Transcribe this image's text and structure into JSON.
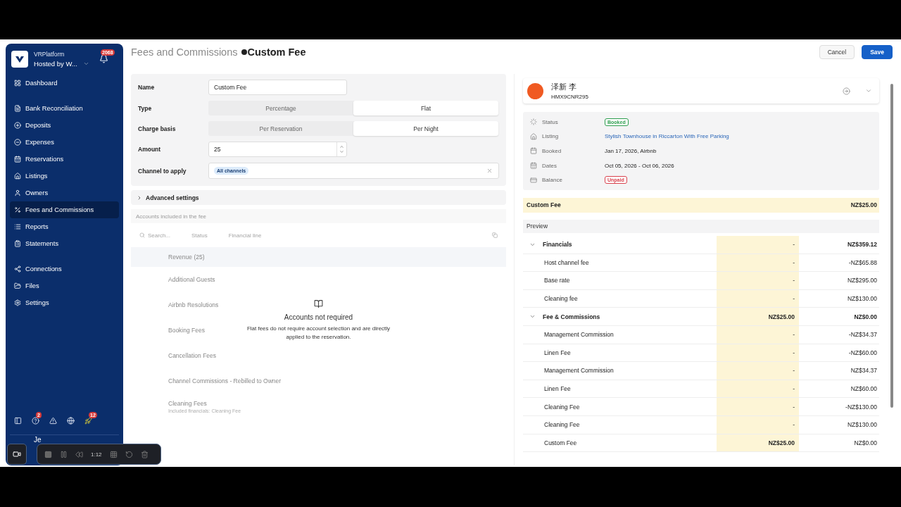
{
  "sidebar": {
    "org": "VRPlatform",
    "account": "Hosted by W...",
    "notification_count": "2068",
    "groups": [
      [
        {
          "label": "Dashboard",
          "selected": false
        }
      ],
      [
        {
          "label": "Bank Reconciliation",
          "selected": false
        },
        {
          "label": "Deposits",
          "selected": false
        },
        {
          "label": "Expenses",
          "selected": false
        },
        {
          "label": "Reservations",
          "selected": false
        },
        {
          "label": "Listings",
          "selected": false
        },
        {
          "label": "Owners",
          "selected": false
        },
        {
          "label": "Fees and Commissions",
          "selected": true
        },
        {
          "label": "Reports",
          "selected": false
        },
        {
          "label": "Statements",
          "selected": false
        }
      ],
      [
        {
          "label": "Connections",
          "selected": false
        },
        {
          "label": "Files",
          "selected": false
        },
        {
          "label": "Settings",
          "selected": false
        }
      ]
    ],
    "footer_icons": [
      {
        "kind": "panel"
      },
      {
        "kind": "help",
        "count": "2"
      },
      {
        "kind": "warning"
      },
      {
        "kind": "globe"
      },
      {
        "kind": "rocket",
        "count": "12"
      }
    ],
    "user": "Je"
  },
  "header": {
    "breadcrumb": "Fees and Commissions",
    "title": "Custom Fee",
    "buttons": [
      {
        "label": "Cancel",
        "kind": "secondary"
      },
      {
        "label": "Save",
        "kind": "primary"
      }
    ]
  },
  "form": {
    "fields": [
      {
        "label": "Name",
        "kind": "text",
        "value": "Custom Fee"
      },
      {
        "label": "Type",
        "kind": "segmented",
        "options": [
          {
            "label": "Percentage",
            "selected": false
          },
          {
            "label": "Flat",
            "selected": true
          }
        ]
      },
      {
        "label": "Charge basis",
        "kind": "segmented",
        "options": [
          {
            "label": "Per Reservation",
            "selected": false
          },
          {
            "label": "Per Night",
            "selected": true
          }
        ]
      },
      {
        "label": "Amount",
        "kind": "number",
        "value": "25"
      },
      {
        "label": "Channel to apply",
        "kind": "tags",
        "tags": [
          "All channels"
        ]
      }
    ],
    "advanced": {
      "label": "Advanced settings",
      "expanded": false
    }
  },
  "accounts": {
    "title": "Accounts included in the fee",
    "search_placeholder": "Search...",
    "filters": [
      "Status",
      "Financial line"
    ],
    "group": "Revenue (25)",
    "items": [
      {
        "name": "Additional Guests"
      },
      {
        "name": "Airbnb Resolutions"
      },
      {
        "name": "Booking Fees"
      },
      {
        "name": "Cancellation Fees"
      },
      {
        "name": "Channel Commissions - Rebilled to Owner"
      },
      {
        "name": "Cleaning Fees",
        "detail": "Included financials: Cleaning Fee"
      }
    ],
    "notice": {
      "title": "Accounts not required",
      "message": "Flat fees do not require account selection and are directly applied to the reservation."
    }
  },
  "reservation": {
    "guest": "泽新 李",
    "code": "HMX9CNR295",
    "details": [
      {
        "label": "Status",
        "value": "Booked",
        "kind": "badge",
        "color": "#2e9e4f"
      },
      {
        "label": "Listing",
        "value": "Stylish Townhouse in Riccarton With Free Parking",
        "kind": "link"
      },
      {
        "label": "Booked",
        "value": "Jan 17, 2026, Airbnb",
        "kind": "text"
      },
      {
        "label": "Dates",
        "value": "Oct 05, 2026 - Oct 06, 2026",
        "kind": "text"
      },
      {
        "label": "Balance",
        "value": "Unpaid",
        "kind": "badge",
        "color": "#d9434f"
      }
    ]
  },
  "fee_summary": {
    "label": "Custom Fee",
    "amount": "NZ$25.00"
  },
  "preview": {
    "title": "Preview",
    "rows": [
      {
        "label": "Financials",
        "fee": "-",
        "total": "NZ$359.12",
        "expanded": true,
        "children": [
          {
            "label": "Host channel fee",
            "fee": "-",
            "total": "-NZ$65.88"
          },
          {
            "label": "Base rate",
            "fee": "-",
            "total": "NZ$295.00"
          },
          {
            "label": "Cleaning fee",
            "fee": "-",
            "total": "NZ$130.00"
          }
        ]
      },
      {
        "label": "Fee & Commissions",
        "fee": "NZ$25.00",
        "total": "NZ$0.00",
        "expanded": true,
        "children": [
          {
            "label": "Management Commission",
            "fee": "-",
            "total": "-NZ$34.37"
          },
          {
            "label": "Linen Fee",
            "fee": "-",
            "total": "-NZ$60.00"
          },
          {
            "label": "Management Commission",
            "fee": "-",
            "total": "NZ$34.37"
          },
          {
            "label": "Linen Fee",
            "fee": "-",
            "total": "NZ$60.00"
          },
          {
            "label": "Cleaning Fee",
            "fee": "-",
            "total": "-NZ$130.00"
          },
          {
            "label": "Cleaning Fee",
            "fee": "-",
            "total": "NZ$130.00"
          },
          {
            "label": "Custom Fee",
            "fee": "NZ$25.00",
            "total": "NZ$0.00"
          }
        ]
      }
    ]
  },
  "recorder": {
    "time": "1:12"
  }
}
